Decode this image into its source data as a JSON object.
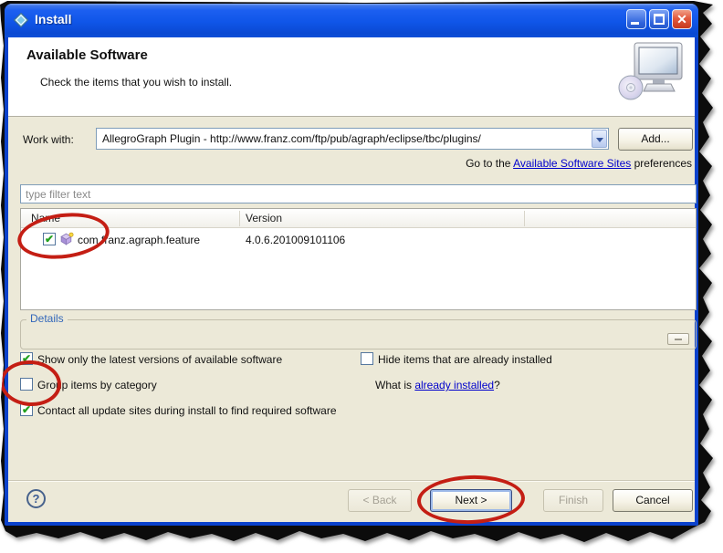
{
  "titlebar": {
    "title": "Install"
  },
  "icons": {
    "close_glyph": "✕",
    "help_glyph": "?"
  },
  "banner": {
    "title": "Available Software",
    "subtitle": "Check the items that you wish to install."
  },
  "work_with": {
    "label": "Work with:",
    "value": "AllegroGraph Plugin - http://www.franz.com/ftp/pub/agraph/eclipse/tbc/plugins/",
    "add_button": "Add...",
    "sites_prefix": "Go to the ",
    "sites_link": "Available Software Sites",
    "sites_suffix": " preferences"
  },
  "filter": {
    "placeholder": "type filter text"
  },
  "table": {
    "columns": [
      "Name",
      "Version"
    ],
    "rows": [
      {
        "name": "com.franz.agraph.feature",
        "version": "4.0.6.201009101106",
        "checked": true,
        "glyph": "✔"
      }
    ]
  },
  "details": {
    "label": "Details"
  },
  "options": {
    "left": [
      {
        "label": "Show only the latest versions of available software",
        "checked": true,
        "glyph": "✔"
      },
      {
        "label": "Group items by category",
        "checked": false,
        "glyph": ""
      },
      {
        "label": "Contact all update sites during install to find required software",
        "checked": true,
        "glyph": "✔"
      }
    ],
    "right": [
      {
        "label": "Hide items that are already installed",
        "checked": false,
        "glyph": ""
      }
    ],
    "what_is": {
      "prefix": "What is ",
      "link": "already installed",
      "suffix": "?"
    }
  },
  "buttons": {
    "back": "< Back",
    "next": "Next >",
    "finish": "Finish",
    "cancel": "Cancel"
  },
  "colors": {
    "titlebar_blue": "#0f55e8",
    "dialog_bg": "#ece9d8",
    "link_blue": "#0000cc",
    "details_blue": "#3267ba",
    "check_green": "#23a11f",
    "annotation_red": "#c41e14"
  }
}
